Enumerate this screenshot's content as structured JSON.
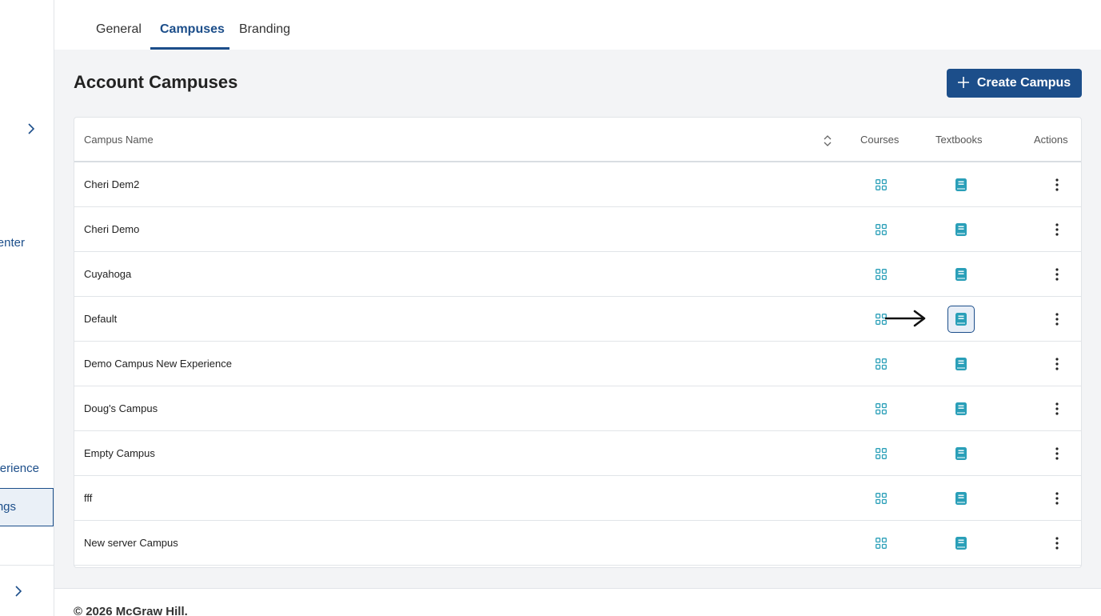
{
  "sidebar": {
    "items": [
      {
        "label": "enter"
      },
      {
        "label": "erience"
      },
      {
        "label": "ngs"
      }
    ]
  },
  "tabs": [
    {
      "label": "General"
    },
    {
      "label": "Campuses",
      "active": true
    },
    {
      "label": "Branding"
    }
  ],
  "page": {
    "title": "Account Campuses",
    "create_button": "Create Campus"
  },
  "table": {
    "columns": {
      "name": "Campus Name",
      "courses": "Courses",
      "textbooks": "Textbooks",
      "actions": "Actions"
    },
    "rows": [
      {
        "name": "Cheri Dem2"
      },
      {
        "name": "Cheri Demo"
      },
      {
        "name": "Cuyahoga"
      },
      {
        "name": "Default"
      },
      {
        "name": "Demo Campus New Experience"
      },
      {
        "name": "Doug's Campus"
      },
      {
        "name": "Empty Campus"
      },
      {
        "name": "fff"
      },
      {
        "name": "New server Campus"
      }
    ]
  },
  "footer": {
    "copyright": "© 2026 McGraw Hill."
  },
  "colors": {
    "primary": "#1c4e8a",
    "icon_teal": "#2a9fb8",
    "background": "#f3f4f6"
  },
  "icons": {
    "courses": "grid-icon",
    "textbooks": "book-icon",
    "actions": "more-vertical-icon",
    "sort": "sort-icon",
    "create": "plus-icon",
    "sidebar_expand": "chevron-right-icon"
  }
}
